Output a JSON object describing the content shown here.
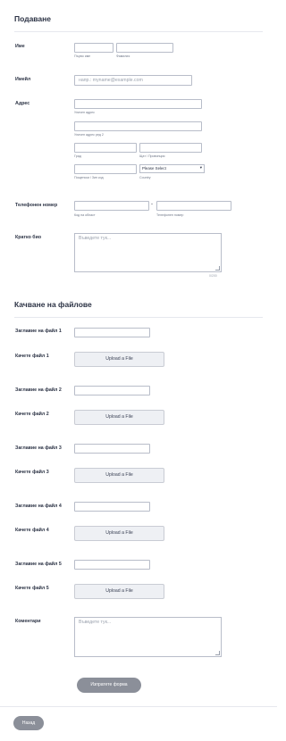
{
  "section_submit": {
    "title": "Подаване"
  },
  "name": {
    "label": "Име",
    "first_sub": "Първо име",
    "last_sub": "Фамилия"
  },
  "email": {
    "label": "Имейл",
    "placeholder": "напр.: myname@example.com"
  },
  "address": {
    "label": "Адрес",
    "street_sub": "Уличен адрес",
    "street2_sub": "Уличен адрес ред 2",
    "city_sub": "Град",
    "state_sub": "Щат / Провинция",
    "zip_sub": "Пощенски / Зип код",
    "country_select": "Please Select",
    "country_sub": "Country"
  },
  "phone": {
    "label": "Телефонен номер",
    "area_sub": "Код на област",
    "number_sub": "Телефонен номер",
    "dash": "-"
  },
  "bio": {
    "label": "Кратко био",
    "placeholder": "Въведете тук...",
    "counter": "0/200"
  },
  "section_files": {
    "title": "Качване на файлове"
  },
  "files": [
    {
      "title_label": "Заглавие на файл 1",
      "upload_label": "Качете файл 1",
      "button": "Upload a File"
    },
    {
      "title_label": "Заглавие на файл 2",
      "upload_label": "Качете файл 2",
      "button": "Upload a File"
    },
    {
      "title_label": "Заглавие на файл 3",
      "upload_label": "Качете файл 3",
      "button": "Upload a File"
    },
    {
      "title_label": "Заглавие на файл 4",
      "upload_label": "Качете файл 4",
      "button": "Upload a File"
    },
    {
      "title_label": "Заглавие на файл 5",
      "upload_label": "Качете файл 5",
      "button": "Upload a File"
    }
  ],
  "comments": {
    "label": "Коментари",
    "placeholder": "Въведете тук..."
  },
  "submit_button": "Изпратете форма",
  "back_button": "Назад"
}
